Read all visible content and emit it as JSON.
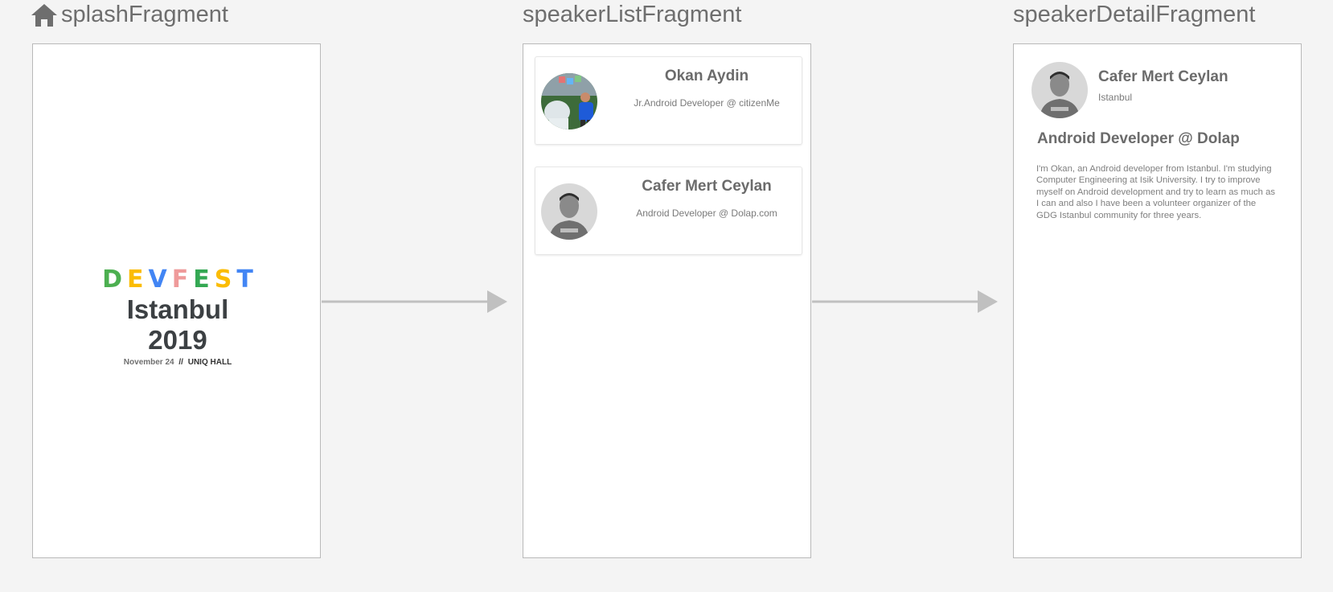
{
  "fragments": {
    "splash": {
      "title": "splashFragment",
      "logo_letters": [
        {
          "ch": "D",
          "color": "#4caf50"
        },
        {
          "ch": "E",
          "color": "#fbbc04"
        },
        {
          "ch": "V",
          "color": "#4285f4"
        },
        {
          "ch": "F",
          "color": "#ef9a9a"
        },
        {
          "ch": "E",
          "color": "#34a853"
        },
        {
          "ch": "S",
          "color": "#fbbc04"
        },
        {
          "ch": "T",
          "color": "#4285f4"
        }
      ],
      "city_year": "Istanbul 2019",
      "date": "November 24",
      "separator": "//",
      "venue": "UNIQ HALL"
    },
    "speaker_list": {
      "title": "speakerListFragment",
      "speakers": [
        {
          "name": "Okan Aydin",
          "role": "Jr.Android Developer @ citizenMe"
        },
        {
          "name": "Cafer Mert Ceylan",
          "role": "Android Developer @ Dolap.com"
        }
      ]
    },
    "speaker_detail": {
      "title": "speakerDetailFragment",
      "name": "Cafer Mert Ceylan",
      "city": "Istanbul",
      "headline": "Android Developer @ Dolap",
      "bio": "I'm Okan, an Android developer from Istanbul. I'm studying Computer Engineering at Isik University. I try to improve myself on Android development and try to learn as much as I can and also I have been a volunteer organizer of the GDG Istanbul community for three years."
    }
  },
  "colors": {
    "background": "#f4f4f4",
    "arrow": "#c0c0c0",
    "title_text": "#6e6e6e"
  },
  "icons": {
    "start_destination": "home-icon",
    "transition": "arrow-right-icon"
  }
}
